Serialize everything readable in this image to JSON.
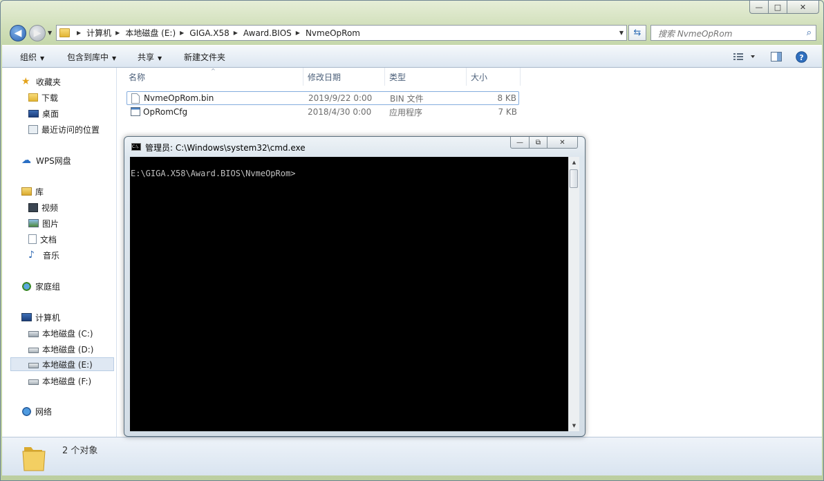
{
  "window": {
    "caption_buttons": {
      "minimize": "—",
      "maximize": "□",
      "close": "✕"
    }
  },
  "address_bar": {
    "crumbs": [
      "计算机",
      "本地磁盘 (E:)",
      "GIGA.X58",
      "Award.BIOS",
      "NvmeOpRom"
    ],
    "icon": "folder-icon"
  },
  "search": {
    "placeholder": "搜索 NvmeOpRom"
  },
  "toolbar": {
    "organize": "组织",
    "include_in_library": "包含到库中",
    "share": "共享",
    "new_folder": "新建文件夹"
  },
  "navpane": {
    "favorites": {
      "label": "收藏夹",
      "items": [
        "下载",
        "桌面",
        "最近访问的位置"
      ]
    },
    "wps": "WPS网盘",
    "libraries": {
      "label": "库",
      "items": [
        "视频",
        "图片",
        "文档",
        "音乐"
      ]
    },
    "homegroup": "家庭组",
    "computer": {
      "label": "计算机",
      "items": [
        "本地磁盘 (C:)",
        "本地磁盘 (D:)",
        "本地磁盘 (E:)",
        "本地磁盘 (F:)"
      ],
      "selected": "本地磁盘 (E:)"
    },
    "network": "网络"
  },
  "columns": {
    "name": "名称",
    "date": "修改日期",
    "type": "类型",
    "size": "大小"
  },
  "files": [
    {
      "name": "NvmeOpRom.bin",
      "date": "2019/9/22 0:00",
      "type": "BIN 文件",
      "size": "8 KB"
    },
    {
      "name": "OpRomCfg",
      "date": "2018/4/30 0:00",
      "type": "应用程序",
      "size": "7 KB"
    }
  ],
  "status": {
    "count_text": "2 个对象"
  },
  "cmd": {
    "title": "管理员: C:\\Windows\\system32\\cmd.exe",
    "icon_text": "C:\\.",
    "prompt": "E:\\GIGA.X58\\Award.BIOS\\NvmeOpRom>"
  }
}
